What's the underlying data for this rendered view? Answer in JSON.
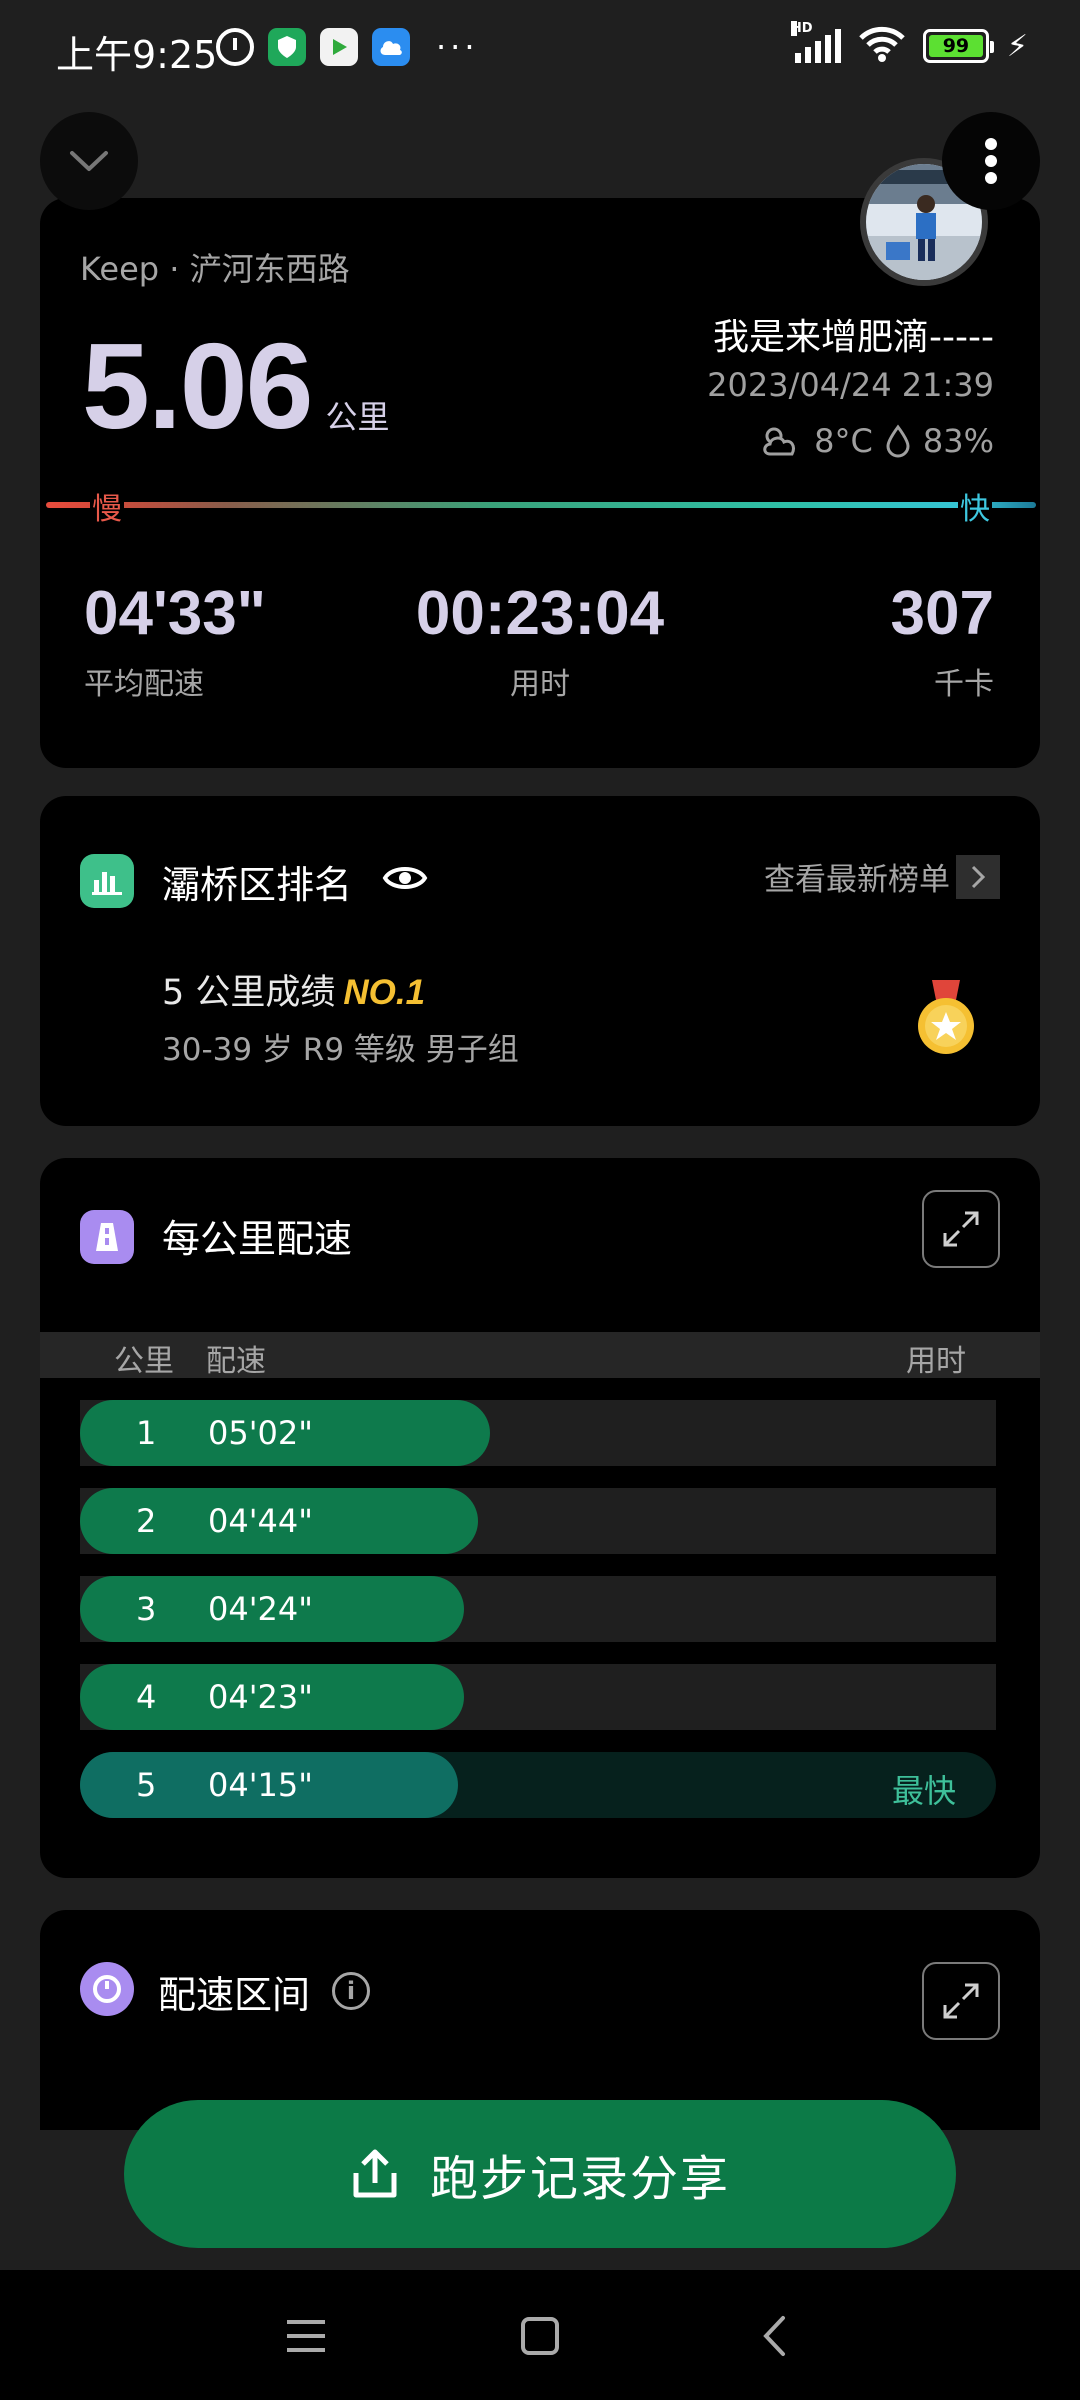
{
  "status_bar": {
    "time": "上午9:25",
    "network": "HD",
    "battery": "99"
  },
  "summary": {
    "source": "Keep · 浐河东西路",
    "distance": "5.06",
    "distance_unit": "公里",
    "user_name": "我是来增肥滴-----",
    "datetime": "2023/04/24 21:39",
    "temperature": "8°C",
    "humidity": "83%",
    "slow_label": "慢",
    "fast_label": "快",
    "metrics": [
      {
        "value": "04'33\"",
        "label": "平均配速"
      },
      {
        "value": "00:23:04",
        "label": "用时"
      },
      {
        "value": "307",
        "label": "千卡"
      }
    ]
  },
  "ranking": {
    "title": "灞桥区排名",
    "link": "查看最新榜单",
    "result_prefix": "5 公里成绩",
    "result_rank": "NO.1",
    "group": "30-39 岁 R9 等级 男子组"
  },
  "pace": {
    "title": "每公里配速",
    "headers": {
      "km": "公里",
      "pace": "配速",
      "time": "用时"
    },
    "rows": [
      {
        "km": "1",
        "pace": "05'02\"",
        "tag": ""
      },
      {
        "km": "2",
        "pace": "04'44\"",
        "tag": ""
      },
      {
        "km": "3",
        "pace": "04'24\"",
        "tag": ""
      },
      {
        "km": "4",
        "pace": "04'23\"",
        "tag": ""
      },
      {
        "km": "5",
        "pace": "04'15\"",
        "tag": "最快"
      }
    ]
  },
  "zone": {
    "title": "配速区间"
  },
  "share_button": "跑步记录分享",
  "colors": {
    "accent_green": "#0c7a47",
    "pace_fill": "#0e7a4c",
    "pace_fastest": "#0f6e62",
    "medal_gold": "#f5c032",
    "rank_icon": "#3ec08a",
    "pace_icon": "#a98cf0"
  }
}
